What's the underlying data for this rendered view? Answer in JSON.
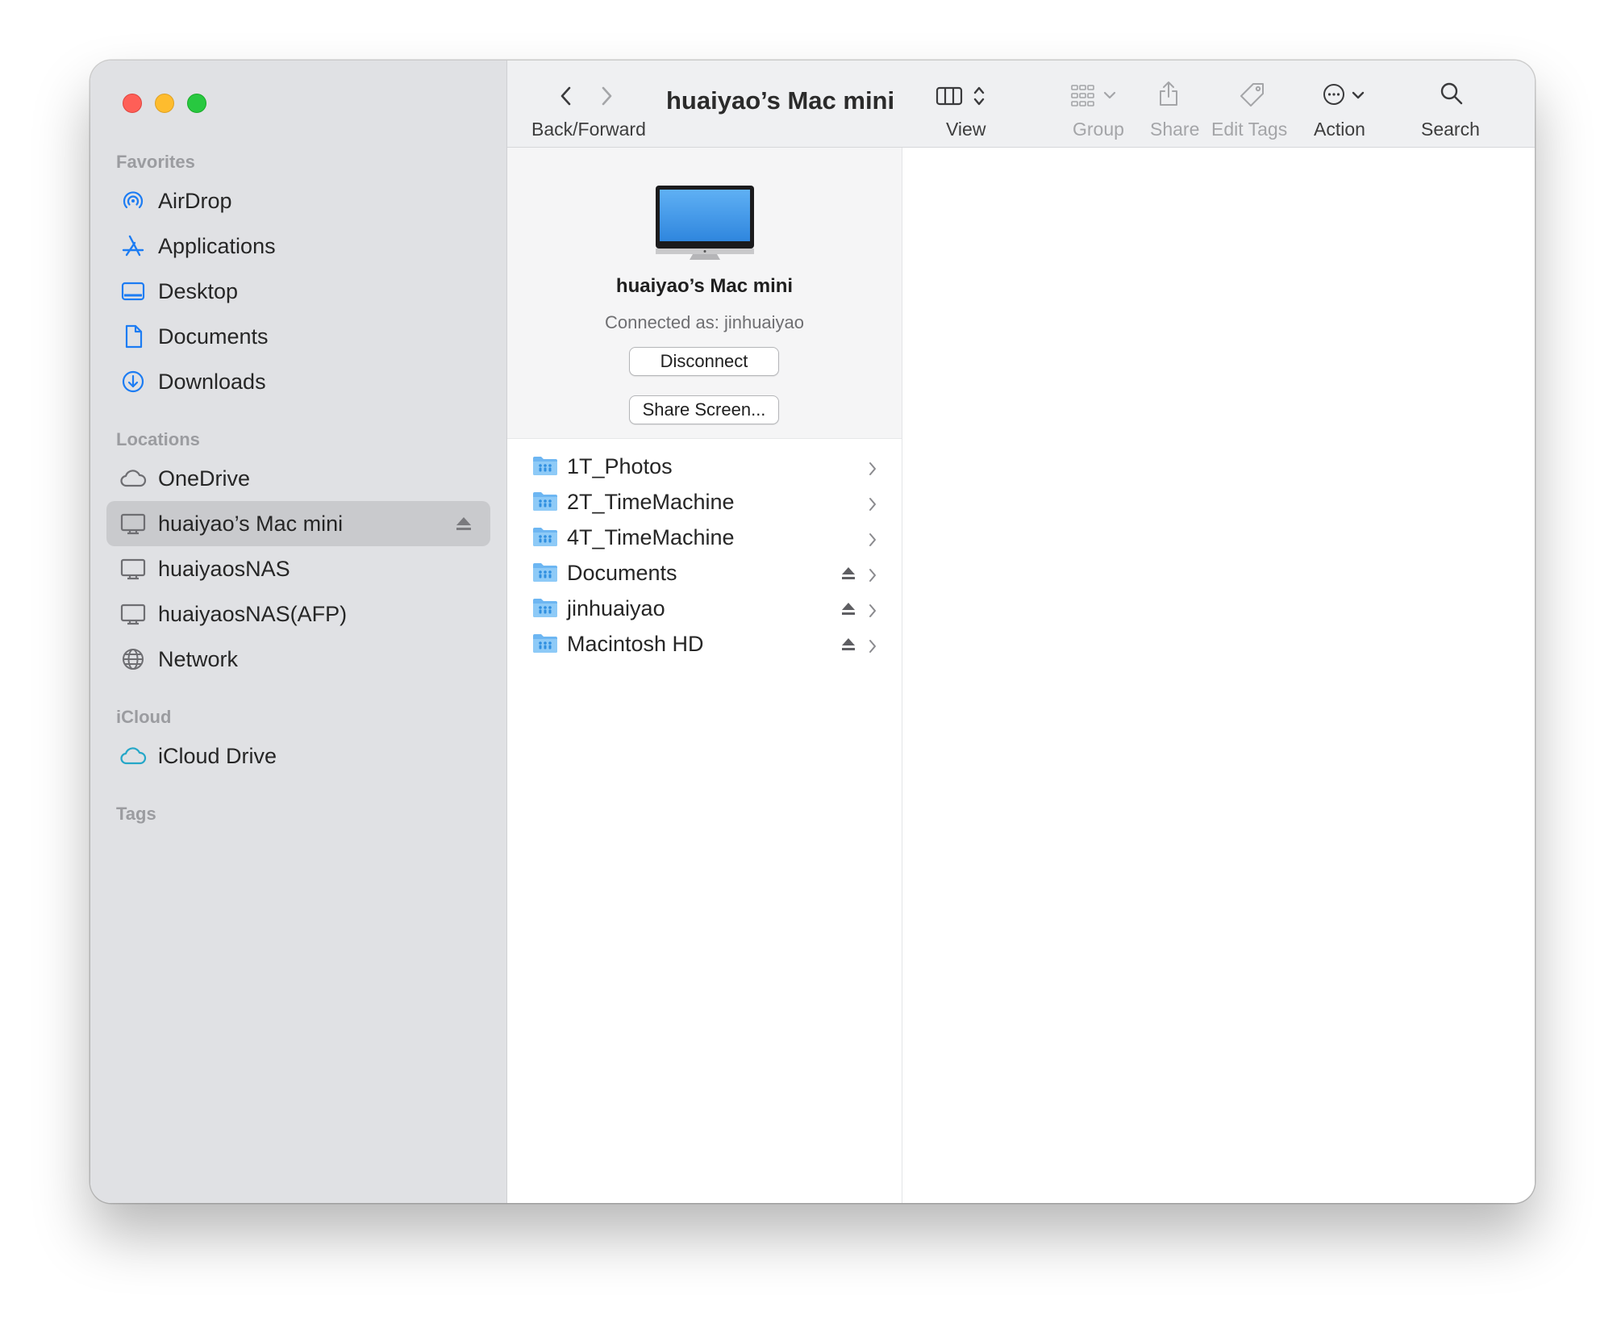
{
  "window": {
    "title": "huaiyao’s Mac mini"
  },
  "sidebar": {
    "favorites_header": "Favorites",
    "locations_header": "Locations",
    "icloud_header": "iCloud",
    "tags_header": "Tags",
    "favorites": [
      {
        "label": "AirDrop",
        "icon": "airdrop-icon"
      },
      {
        "label": "Applications",
        "icon": "applications-icon"
      },
      {
        "label": "Desktop",
        "icon": "desktop-icon"
      },
      {
        "label": "Documents",
        "icon": "document-icon"
      },
      {
        "label": "Downloads",
        "icon": "downloads-icon"
      }
    ],
    "locations": [
      {
        "label": "OneDrive",
        "icon": "cloud-icon"
      },
      {
        "label": "huaiyao’s Mac mini",
        "icon": "computer-icon",
        "selected": true,
        "eject": true
      },
      {
        "label": "huaiyaosNAS",
        "icon": "computer-icon"
      },
      {
        "label": "huaiyaosNAS(AFP)",
        "icon": "computer-icon"
      },
      {
        "label": "Network",
        "icon": "globe-icon"
      }
    ],
    "icloud": [
      {
        "label": "iCloud Drive",
        "icon": "icloud-icon"
      }
    ]
  },
  "toolbar": {
    "back_forward_label": "Back/Forward",
    "view_label": "View",
    "group_label": "Group",
    "share_label": "Share",
    "edit_tags_label": "Edit Tags",
    "action_label": "Action",
    "search_label": "Search"
  },
  "preview": {
    "name": "huaiyao’s Mac mini",
    "connected_as": "Connected as: jinhuaiyao",
    "disconnect_label": "Disconnect",
    "share_screen_label": "Share Screen..."
  },
  "volumes": [
    {
      "label": "1T_Photos",
      "eject": false
    },
    {
      "label": "2T_TimeMachine",
      "eject": false
    },
    {
      "label": "4T_TimeMachine",
      "eject": false
    },
    {
      "label": "Documents",
      "eject": true
    },
    {
      "label": "jinhuaiyao",
      "eject": true
    },
    {
      "label": "Macintosh HD",
      "eject": true
    }
  ],
  "colors": {
    "accent": "#1c7cf3",
    "sidebar_bg": "#e0e1e4",
    "selected_bg": "#c9cacd",
    "toolbar_bg": "#eff0f2"
  }
}
